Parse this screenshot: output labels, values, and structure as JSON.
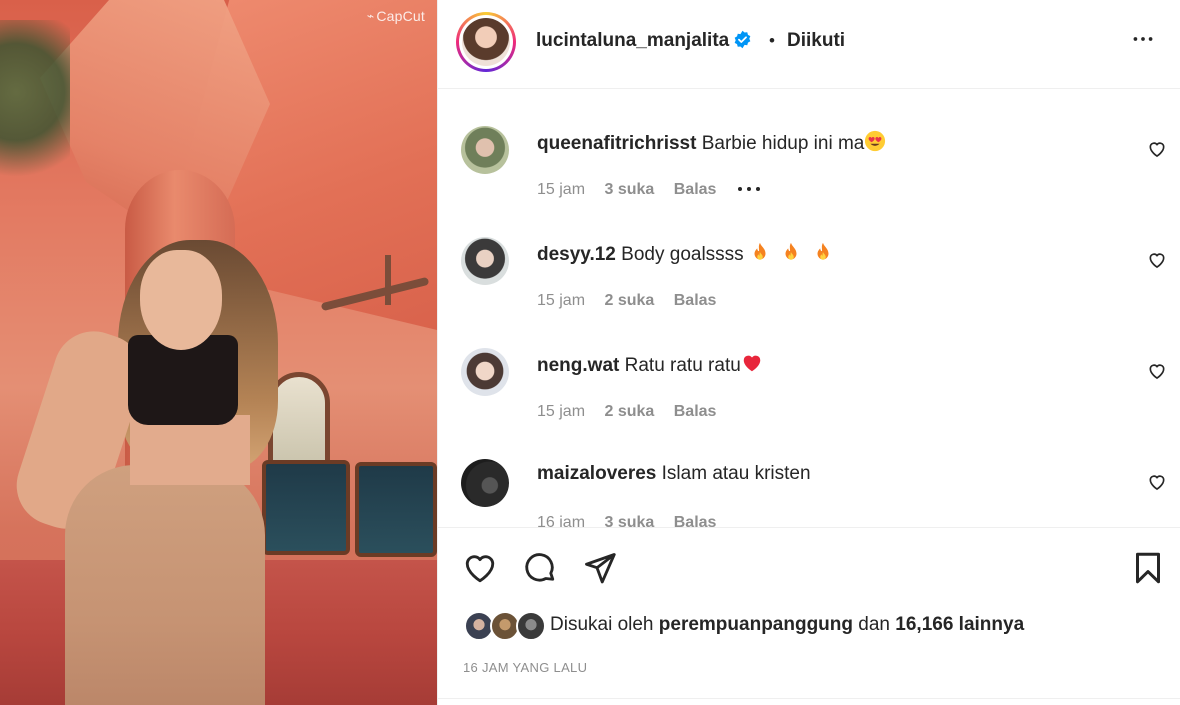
{
  "media": {
    "watermark": "CapCut"
  },
  "header": {
    "username": "lucintaluna_manjalita",
    "separator": "•",
    "follow_status": "Diikuti",
    "more_icon": "more-horizontal-icon"
  },
  "comments": [
    {
      "username": "queenafitrichrisst",
      "text": "Barbie hidup ini ma",
      "emoji": "smiling-face-with-heart-eyes",
      "time": "15 jam",
      "likes": "3 suka",
      "reply": "Balas",
      "has_options": true
    },
    {
      "username": "desyy.12",
      "text": "Body goalssss",
      "emoji": "fire-x3",
      "time": "15 jam",
      "likes": "2 suka",
      "reply": "Balas",
      "has_options": false
    },
    {
      "username": "neng.wat",
      "text": "Ratu ratu ratu",
      "emoji": "red-heart",
      "time": "15 jam",
      "likes": "2 suka",
      "reply": "Balas",
      "has_options": false
    },
    {
      "username": "maizaloveres",
      "text": "Islam atau kristen",
      "emoji": "",
      "time": "16 jam",
      "likes": "3 suka",
      "reply": "Balas",
      "has_options": false
    }
  ],
  "actions": {
    "like_icon": "heart-icon",
    "comment_icon": "comment-icon",
    "share_icon": "send-icon",
    "save_icon": "bookmark-icon"
  },
  "likes": {
    "prefix": "Disukai oleh",
    "first_user": "perempuanpanggung",
    "connector": "dan",
    "others": "16,166 lainnya"
  },
  "timestamp": "16 JAM YANG LALU",
  "colors": {
    "text": "#262626",
    "secondary": "#8e8e8e",
    "verified": "#0095f6",
    "divider": "#efefef"
  }
}
